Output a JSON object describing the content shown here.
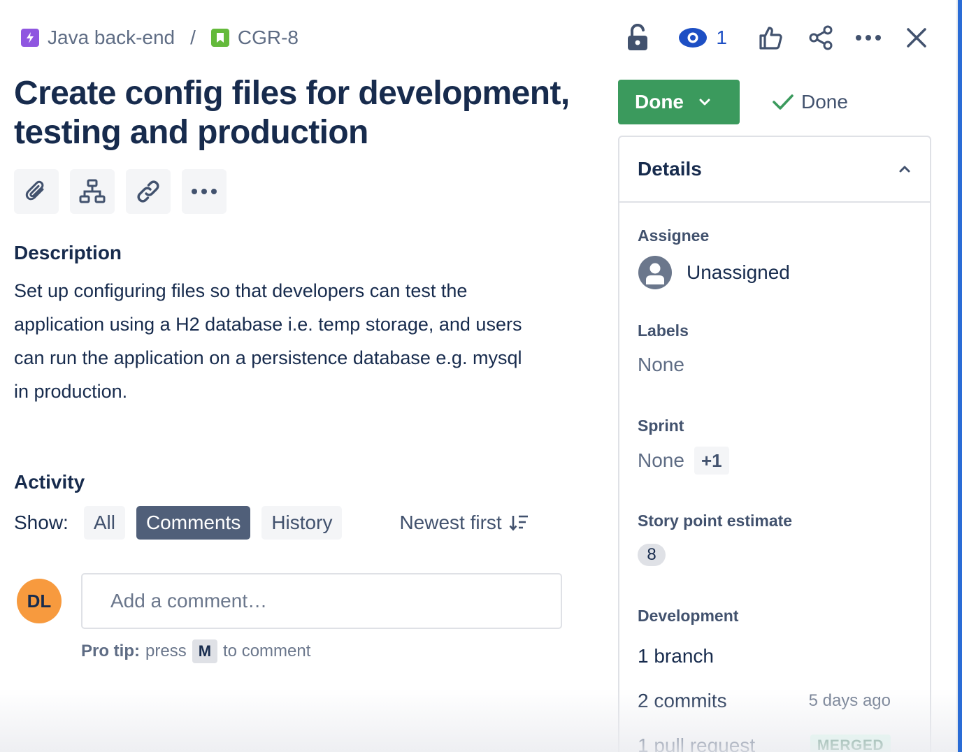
{
  "breadcrumb": {
    "project": "Java back-end",
    "separator": "/",
    "issue_key": "CGR-8"
  },
  "toolbar": {
    "watchers_count": "1",
    "icons": [
      "lock-icon",
      "eye-icon",
      "thumbs-up-icon",
      "share-icon",
      "more-icon",
      "close-icon"
    ]
  },
  "issue": {
    "title": "Create config files for development, testing and production",
    "action_icons": [
      "attachment-icon",
      "hierarchy-icon",
      "link-icon",
      "more-icon"
    ]
  },
  "description": {
    "heading": "Description",
    "body": "Set up configuring files so that developers can test the application using a H2 database i.e. temp storage, and users can run the application on a persistence database e.g. mysql in production."
  },
  "activity": {
    "heading": "Activity",
    "show_label": "Show:",
    "filters": [
      {
        "label": "All",
        "active": false
      },
      {
        "label": "Comments",
        "active": true
      },
      {
        "label": "History",
        "active": false
      }
    ],
    "sort_label": "Newest first"
  },
  "comment": {
    "avatar_initials": "DL",
    "placeholder": "Add a comment…",
    "pro_tip_label": "Pro tip:",
    "pro_tip_press": "press",
    "pro_tip_key": "M",
    "pro_tip_suffix": "to comment"
  },
  "status": {
    "button_label": "Done",
    "resolution": "Done"
  },
  "details": {
    "heading": "Details",
    "assignee": {
      "label": "Assignee",
      "value": "Unassigned"
    },
    "labels": {
      "label": "Labels",
      "value": "None"
    },
    "sprint": {
      "label": "Sprint",
      "value": "None",
      "extra": "+1"
    },
    "story_points": {
      "label": "Story point estimate",
      "value": "8"
    },
    "development": {
      "label": "Development",
      "branch": "1 branch",
      "commits": "2 commits",
      "commits_time": "5 days ago",
      "pull_request": "1 pull request",
      "pr_status": "MERGED"
    }
  },
  "colors": {
    "status_green": "#3b9a5d",
    "watch_blue": "#1d4fc4",
    "active_filter": "#505f79",
    "avatar_orange": "#f79a3e",
    "project_purple": "#8f56e0",
    "story_green": "#64ba3b"
  }
}
